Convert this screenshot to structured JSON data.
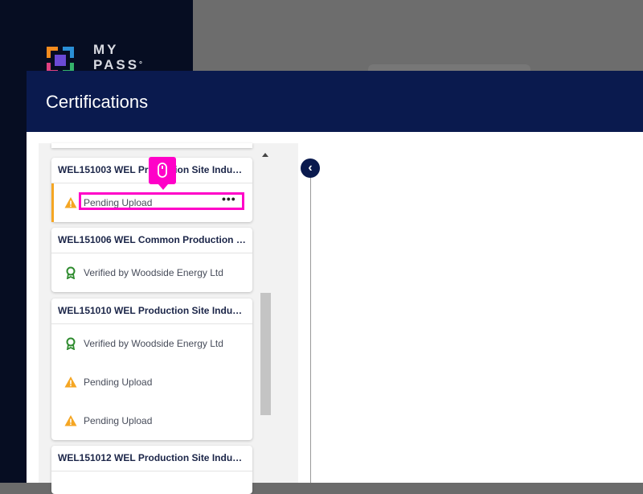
{
  "app": {
    "logo_text_line1": "MY",
    "logo_text_line2": "PASS",
    "logo_sup": "°"
  },
  "modal": {
    "title": "Certifications",
    "collapse_icon": "chevron-left-icon"
  },
  "certifications": [
    {
      "title": "WEL151003 WEL Production Site Induct...",
      "items": [
        {
          "status": "Pending Upload",
          "icon": "warning-icon",
          "selected": true,
          "menu": "•••"
        }
      ]
    },
    {
      "title": "WEL151006 WEL Common Production O...",
      "items": [
        {
          "status": "Verified by Woodside Energy Ltd",
          "icon": "award-icon"
        }
      ]
    },
    {
      "title": "WEL151010 WEL Production Site Inducti...",
      "items": [
        {
          "status": "Verified by Woodside Energy Ltd",
          "icon": "award-icon"
        },
        {
          "status": "Pending Upload",
          "icon": "warning-icon"
        },
        {
          "status": "Pending Upload",
          "icon": "warning-icon"
        }
      ]
    },
    {
      "title": "WEL151012 WEL Production Site Inducti...",
      "items": []
    }
  ],
  "colors": {
    "header": "#0a1a4e",
    "warning": "#f5a623",
    "verified": "#2e8b2e",
    "highlight": "#ff00c8"
  }
}
